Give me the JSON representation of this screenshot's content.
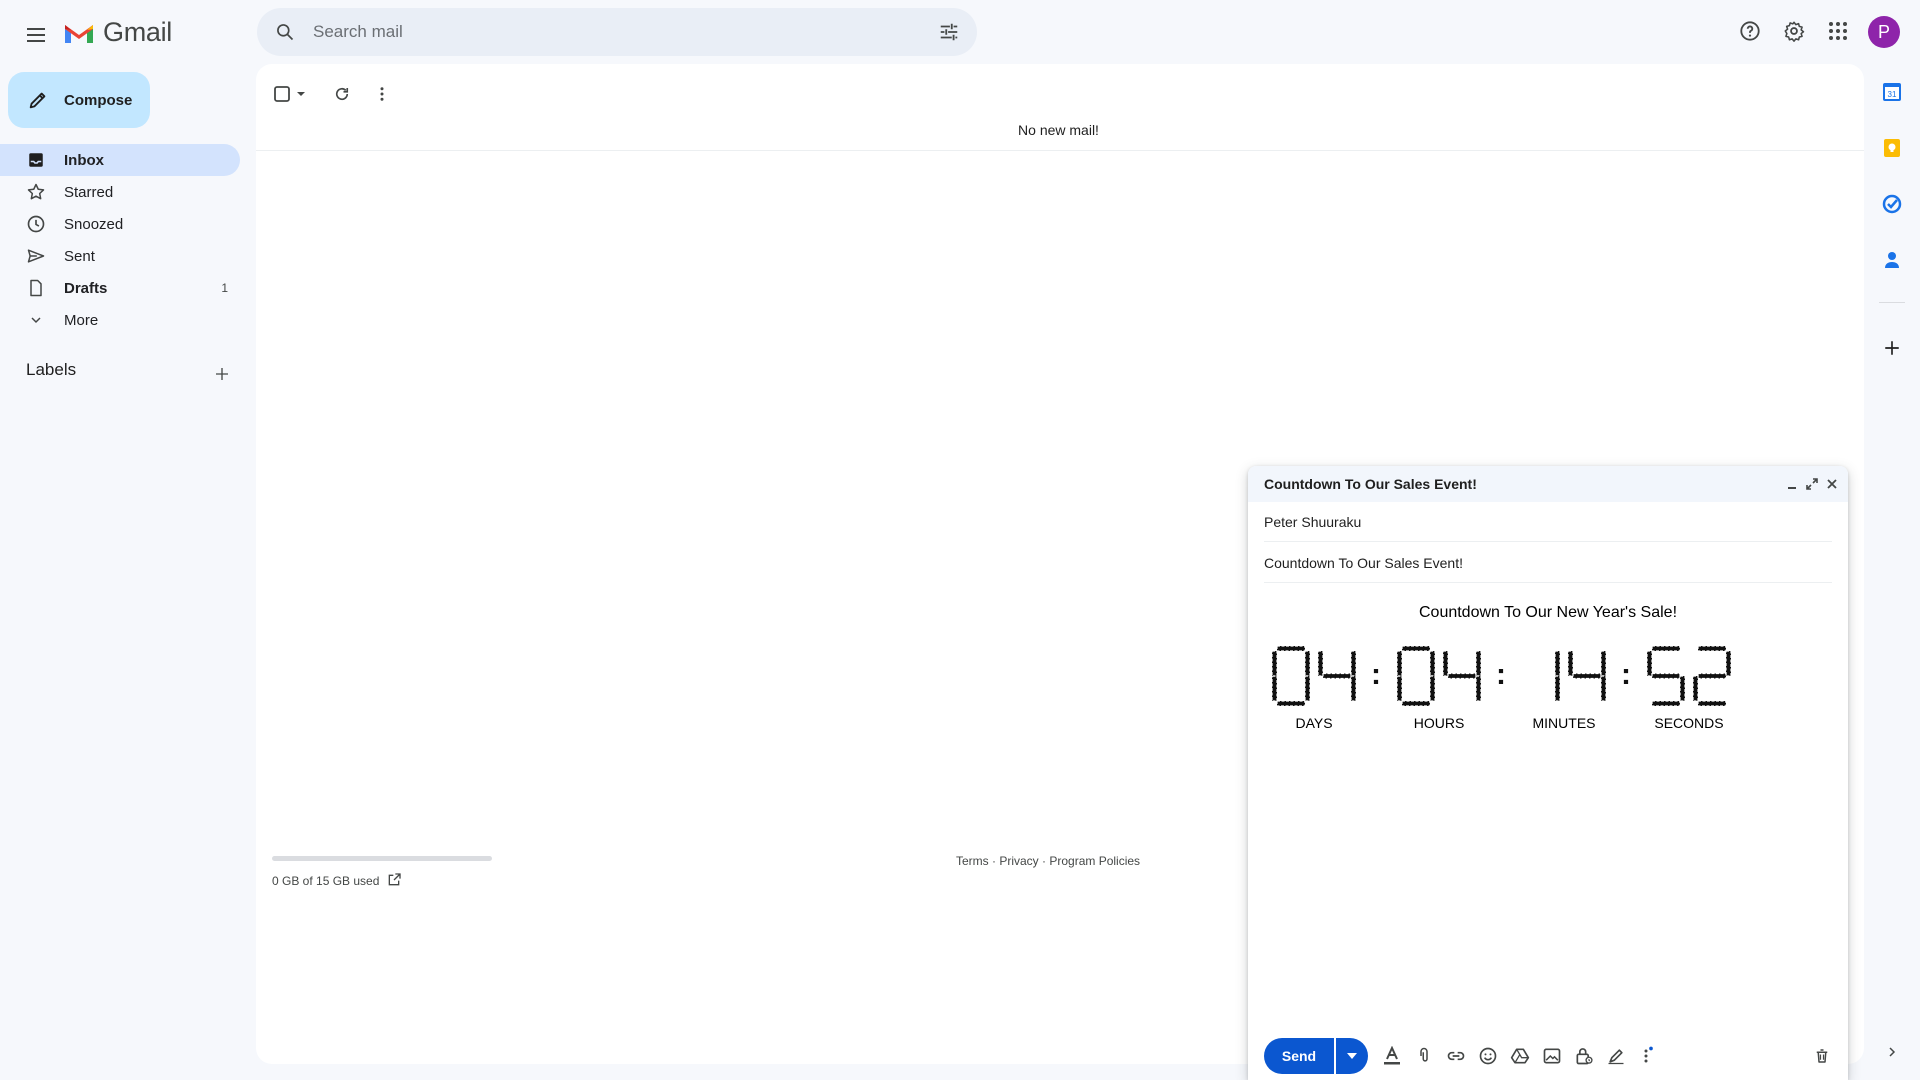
{
  "header": {
    "logo_text": "Gmail",
    "search_placeholder": "Search mail",
    "avatar_letter": "P",
    "avatar_color": "#8e24aa"
  },
  "sidebar": {
    "compose_label": "Compose",
    "items": [
      {
        "label": "Inbox",
        "icon": "inbox-icon",
        "active": true,
        "count": ""
      },
      {
        "label": "Starred",
        "icon": "star-icon",
        "active": false,
        "count": ""
      },
      {
        "label": "Snoozed",
        "icon": "clock-icon",
        "active": false,
        "count": ""
      },
      {
        "label": "Sent",
        "icon": "send-icon",
        "active": false,
        "count": ""
      },
      {
        "label": "Drafts",
        "icon": "draft-icon",
        "active": false,
        "count": "1"
      },
      {
        "label": "More",
        "icon": "chevron-down-icon",
        "active": false,
        "count": ""
      }
    ],
    "labels_heading": "Labels"
  },
  "main": {
    "empty_message": "No new mail!",
    "storage_text": "0 GB of 15 GB used",
    "storage_used_fraction": 0.0,
    "footer_links": [
      "Terms",
      "Privacy",
      "Program Policies"
    ],
    "footer_separator": " · "
  },
  "compose_window": {
    "title": "Countdown To Our Sales Event!",
    "to": "Peter Shuuraku",
    "subject": "Countdown To Our Sales Event!",
    "body_heading": "Countdown To Our New Year's Sale!",
    "countdown": {
      "days": "04",
      "hours": "04",
      "minutes": "14",
      "seconds": "52",
      "labels": [
        "DAYS",
        "HOURS",
        "MINUTES",
        "SECONDS"
      ],
      "separator": ":"
    },
    "send_label": "Send"
  },
  "colors": {
    "accent": "#0b57d0",
    "compose_button": "#c2e7ff",
    "active_nav": "#d3e3fd",
    "background": "#f6f8fc"
  }
}
